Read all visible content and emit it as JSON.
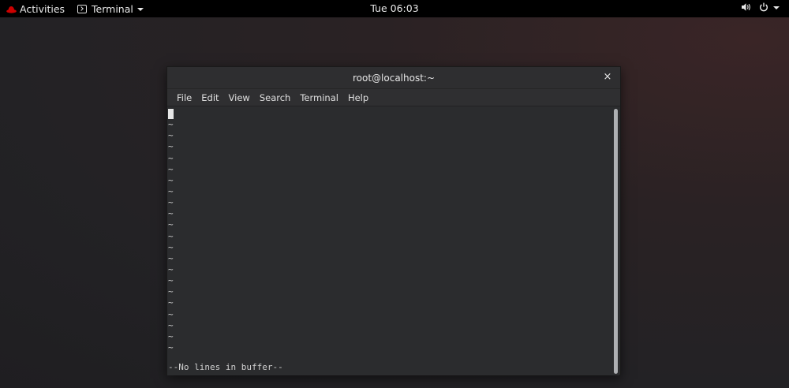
{
  "topbar": {
    "activities_label": "Activities",
    "app_menu_label": "Terminal",
    "clock": "Tue 06:03",
    "icons": {
      "activities": "redhat-icon",
      "app": "terminal-icon",
      "volume": "volume-icon",
      "power": "power-icon"
    }
  },
  "window": {
    "title": "root@localhost:~",
    "close_label": "×",
    "menu": [
      "File",
      "Edit",
      "View",
      "Search",
      "Terminal",
      "Help"
    ]
  },
  "terminal": {
    "tilde": "~",
    "status_text": "--No lines in buffer--"
  },
  "colors": {
    "topbar_bg": "#000000",
    "terminal_bg": "#2b2c2e",
    "accent_red": "#cc0000"
  }
}
